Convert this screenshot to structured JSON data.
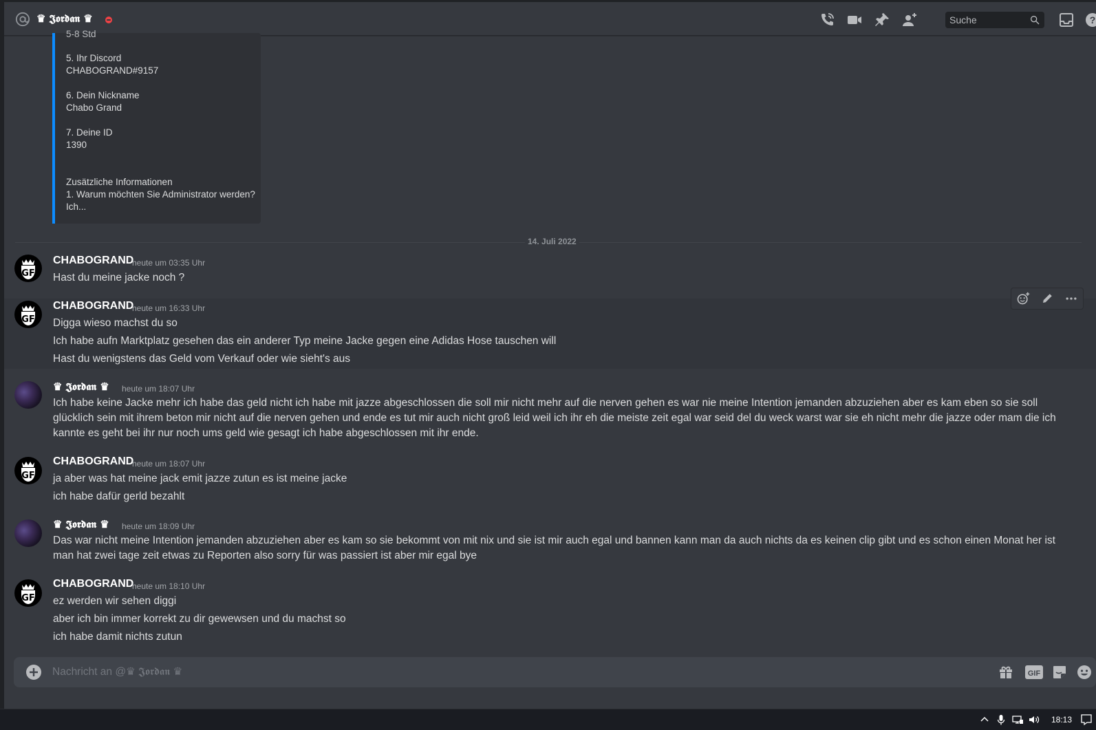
{
  "header": {
    "dm_name": "♛ 𝕵𝖔𝖗𝖉𝖆𝖓 ♛",
    "search_placeholder": "Suche",
    "icons": [
      "at-icon",
      "phone-call-icon",
      "video-icon",
      "pin-icon",
      "add-user-icon",
      "search-icon",
      "inbox-icon",
      "help-icon"
    ]
  },
  "embed": {
    "cut_top": "5-8 Std",
    "field5_label": "5. Ihr Discord",
    "field5_value": "CHABOGRAND#9157",
    "field6_label": "6. Dein Nickname",
    "field6_value": "Chabo Grand",
    "field7_label": "7. Deine ID",
    "field7_value": "1390",
    "extra_title": "Zusätzliche Informationen",
    "extra_q1": "1. Warum möchten Sie Administrator werden?",
    "extra_q1_value": "Ich..."
  },
  "divider": {
    "date": "14. Juli 2022"
  },
  "messages": [
    {
      "author": "CHABOGRAND",
      "time": "heute um 03:35 Uhr",
      "lines": [
        "Hast du meine jacke noch ?"
      ]
    },
    {
      "author": "CHABOGRAND",
      "time": "heute um 16:33 Uhr",
      "lines": [
        "Digga wieso machst du so",
        "Ich habe aufn Marktplatz gesehen das ein anderer Typ meine Jacke gegen eine Adidas Hose tauschen will",
        "Hast du wenigstens das Geld vom Verkauf oder wie sieht's aus"
      ]
    },
    {
      "author": "♛ 𝕵𝖔𝖗𝖉𝖆𝖓 ♛",
      "time": "heute um 18:07 Uhr",
      "lines": [
        "Ich habe keine Jacke mehr ich habe das geld nicht ich habe mit jazze abgeschlossen die soll mir nicht mehr auf die nerven gehen es war nie meine Intention jemanden abzuziehen aber es kam eben so sie soll glücklich sein mit ihrem beton mir nicht auf die nerven gehen und ende es tut mir auch nicht groß leid weil ich ihr eh die meiste zeit egal war seid del du weck warst war sie eh nicht mehr die jazze oder mam die ich kannte es geht bei ihr nur noch ums geld wie gesagt ich habe abgeschlossen mit ihr ende."
      ]
    },
    {
      "author": "CHABOGRAND",
      "time": "heute um 18:07 Uhr",
      "lines": [
        "ja aber was hat meine jack emit jazze zutun es ist meine jacke",
        "ich habe dafür gerld bezahlt"
      ]
    },
    {
      "author": "♛ 𝕵𝖔𝖗𝖉𝖆𝖓 ♛",
      "time": "heute um 18:09 Uhr",
      "lines": [
        "Das war nicht meine Intention jemanden abzuziehen aber es kam so sie bekommt von mit nix und sie ist mir auch egal und bannen kann man da auch nichts da es keinen clip gibt und es schon einen Monat her ist man hat zwei tage zeit etwas zu Reporten also sorry für was passiert ist aber mir egal bye"
      ]
    },
    {
      "author": "CHABOGRAND",
      "time": "heute um 18:10 Uhr",
      "lines": [
        "ez werden wir sehen diggi",
        "aber ich bin immer korrekt zu dir gewewsen und du machst so",
        "ich habe damit nichts zutun"
      ]
    }
  ],
  "composer": {
    "placeholder": "Nachricht an @♛ 𝕵𝖔𝖗𝖉𝖆𝖓 ♛",
    "gif_label": "GIF"
  },
  "taskbar": {
    "clock": "18:13"
  },
  "colors": {
    "background": "#36393f",
    "embed_accent": "#0d8cff",
    "dnd": "#ed4245"
  }
}
